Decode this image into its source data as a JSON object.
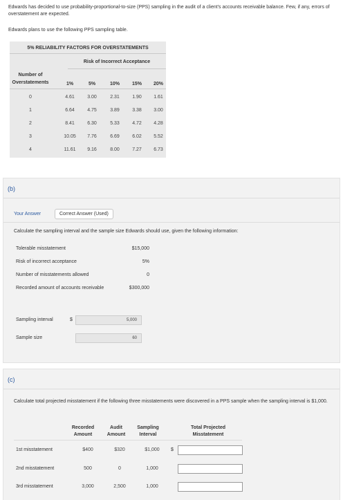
{
  "intro": {
    "text": "Edwards has decided to use probability-proportional-to-size (PPS) sampling in the audit of a client's accounts receivable balance. Few, if any, errors of overstatement are expected.",
    "plans": "Edwards plans to use the following PPS sampling table."
  },
  "reliability_table": {
    "title": "5% RELIABILITY FACTORS FOR OVERSTATEMENTS",
    "subtitle": "Risk of Incorrect Acceptance",
    "row_header_line1": "Number of",
    "row_header_line2": "Overstatements",
    "columns": [
      "1%",
      "5%",
      "10%",
      "15%",
      "20%"
    ],
    "rows": [
      {
        "n": "0",
        "values": [
          "4.61",
          "3.00",
          "2.31",
          "1.90",
          "1.61"
        ]
      },
      {
        "n": "1",
        "values": [
          "6.64",
          "4.75",
          "3.89",
          "3.38",
          "3.00"
        ]
      },
      {
        "n": "2",
        "values": [
          "8.41",
          "6.30",
          "5.33",
          "4.72",
          "4.28"
        ]
      },
      {
        "n": "3",
        "values": [
          "10.05",
          "7.76",
          "6.69",
          "6.02",
          "5.52"
        ]
      },
      {
        "n": "4",
        "values": [
          "11.61",
          "9.16",
          "8.00",
          "7.27",
          "6.73"
        ]
      }
    ]
  },
  "part_b": {
    "letter": "(b)",
    "tab_your_answer": "Your Answer",
    "tab_correct_answer": "Correct Answer (Used)",
    "question": "Calculate the sampling interval and the sample size Edwards should use, given the following information:",
    "info": [
      {
        "label": "Tolerable misstatement",
        "value": "$15,000"
      },
      {
        "label": "Risk of incorrect acceptance",
        "value": "5%"
      },
      {
        "label": "Number of misstatements allowed",
        "value": "0"
      },
      {
        "label": "Recorded amount of accounts receivable",
        "value": "$300,000"
      }
    ],
    "sampling_interval_label": "Sampling interval",
    "sampling_interval_currency": "$",
    "sampling_interval_value": "5,000",
    "sample_size_label": "Sample size",
    "sample_size_value": "60"
  },
  "part_c": {
    "letter": "(c)",
    "question": "Calculate total projected misstatement if the following three misstatements were discovered in a PPS sample when the sampling interval is $1,000.",
    "headers": {
      "recorded_1": "Recorded",
      "recorded_2": "Amount",
      "audit_1": "Audit",
      "audit_2": "Amount",
      "sampling_1": "Sampling",
      "sampling_2": "Interval",
      "total_1": "Total Projected",
      "total_2": "Misstatement"
    },
    "rows": [
      {
        "label": "1st misstatement",
        "recorded": "$400",
        "audit": "$320",
        "interval": "$1,000",
        "currency": "$",
        "total": ""
      },
      {
        "label": "2nd misstatement",
        "recorded": "500",
        "audit": "0",
        "interval": "1,000",
        "currency": "",
        "total": ""
      },
      {
        "label": "3rd misstatement",
        "recorded": "3,000",
        "audit": "2,500",
        "interval": "1,000",
        "currency": "",
        "total": ""
      }
    ]
  }
}
